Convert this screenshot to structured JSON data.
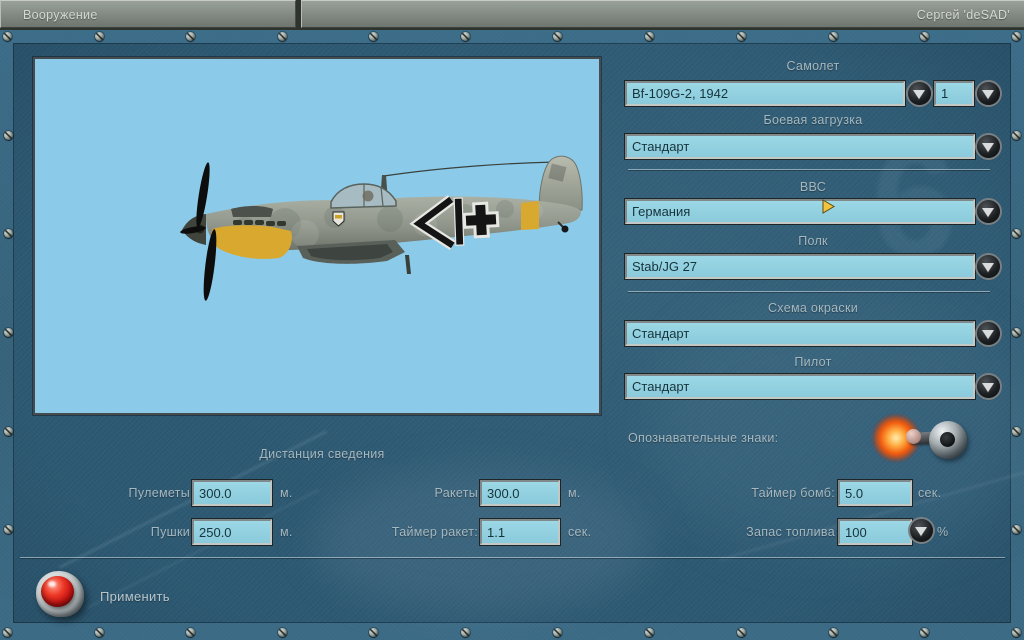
{
  "titlebar": {
    "tab_label": "Вооружение",
    "username": "Сергей 'deSAD'"
  },
  "right_panel": {
    "aircraft": {
      "label": "Самолет",
      "value": "Bf-109G-2, 1942",
      "count": "1"
    },
    "loadout": {
      "label": "Боевая загрузка",
      "value": "Стандарт"
    },
    "airforce": {
      "label": "ВВС",
      "value": "Германия"
    },
    "regiment": {
      "label": "Полк",
      "value": "Stab/JG 27"
    },
    "paint_scheme": {
      "label": "Схема окраски",
      "value": "Стандарт"
    },
    "pilot": {
      "label": "Пилот",
      "value": "Стандарт"
    },
    "markings_label": "Опознавательные знаки:"
  },
  "convergence": {
    "title": "Дистанция сведения",
    "machine_guns": {
      "label": "Пулеметы",
      "value": "300.0",
      "unit": "м."
    },
    "cannons": {
      "label": "Пушки",
      "value": "250.0",
      "unit": "м."
    },
    "rockets": {
      "label": "Ракеты",
      "value": "300.0",
      "unit": "м."
    },
    "rocket_timer": {
      "label": "Таймер ракет:",
      "value": "1.1",
      "unit": "сек."
    },
    "bomb_timer": {
      "label": "Таймер бомб:",
      "value": "5.0",
      "unit": "сек."
    },
    "fuel": {
      "label": "Запас топлива",
      "value": "100",
      "unit": "%"
    }
  },
  "apply_label": "Применить",
  "background": {
    "faint_digit": "6"
  },
  "colors": {
    "field_blue": "#93d0e0",
    "preview_blue": "#8ccaea",
    "content_teal": "#2d5973",
    "glow_orange": "#f1560a",
    "apply_red": "#c21312",
    "topbar_gray": "#868d87"
  }
}
